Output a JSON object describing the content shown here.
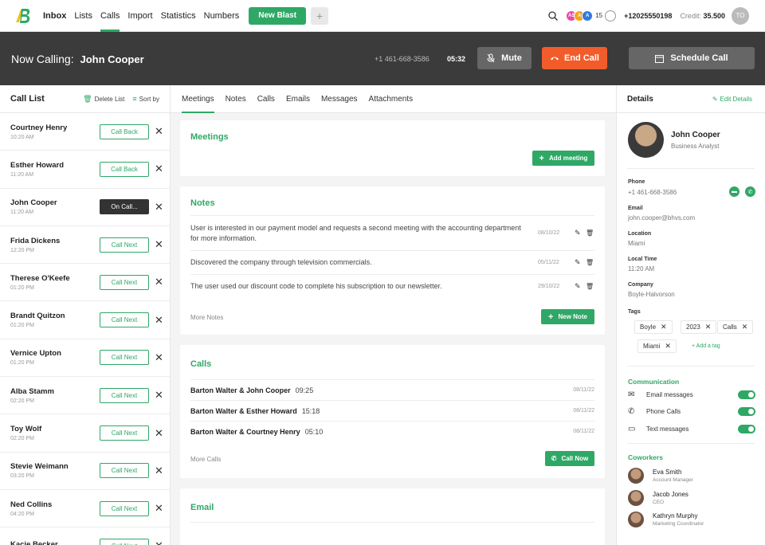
{
  "nav": {
    "items": [
      {
        "label": "Inbox",
        "bold": true,
        "active": false
      },
      {
        "label": "Lists",
        "bold": false,
        "active": false
      },
      {
        "label": "Calls",
        "bold": false,
        "active": true
      },
      {
        "label": "Import",
        "bold": false,
        "active": false
      },
      {
        "label": "Statistics",
        "bold": false,
        "active": false
      },
      {
        "label": "Numbers",
        "bold": false,
        "active": false
      }
    ],
    "new_blast": "New Blast",
    "plus": "+",
    "avatars": [
      {
        "initials": "AS",
        "color": "#e94aa8"
      },
      {
        "initials": "A",
        "color": "#f2a51c"
      },
      {
        "initials": "A",
        "color": "#2f7ae0"
      }
    ],
    "avatar_count": "15",
    "phone": "+12025550198",
    "credit_label": "Credit:",
    "credit_value": "35.500",
    "user_initials": "TO",
    "accent": "#2fa866"
  },
  "banner": {
    "label": "Now Calling:",
    "name": "John Cooper",
    "number": "+1 461-668-3586",
    "timer": "05:32",
    "mute": "Mute",
    "end": "End Call",
    "schedule": "Schedule Call"
  },
  "calllist": {
    "title": "Call List",
    "delete_label": "Delete List",
    "sort_label": "Sort by",
    "rows": [
      {
        "name": "Courtney Henry",
        "time": "10:20 AM",
        "action": "Call Back"
      },
      {
        "name": "Esther Howard",
        "time": "11:20 AM",
        "action": "Call Back"
      },
      {
        "name": "John Cooper",
        "time": "11:20 AM",
        "action": "On Call..."
      },
      {
        "name": "Frida Dickens",
        "time": "12:20 PM",
        "action": "Call Next"
      },
      {
        "name": "Therese O'Keefe",
        "time": "01:20 PM",
        "action": "Call Next"
      },
      {
        "name": "Brandt Quitzon",
        "time": "01:20 PM",
        "action": "Call Next"
      },
      {
        "name": "Vernice Upton",
        "time": "01:20 PM",
        "action": "Call Next"
      },
      {
        "name": "Alba Stamm",
        "time": "02:20 PM",
        "action": "Call Next"
      },
      {
        "name": "Toy Wolf",
        "time": "02:20 PM",
        "action": "Call Next"
      },
      {
        "name": "Stevie Weimann",
        "time": "03:20 PM",
        "action": "Call Next"
      },
      {
        "name": "Ned Collins",
        "time": "04:20 PM",
        "action": "Call Next"
      },
      {
        "name": "Kacie Becker",
        "time": "",
        "action": "Call Next"
      }
    ]
  },
  "tabs": [
    "Meetings",
    "Notes",
    "Calls",
    "Emails",
    "Messages",
    "Attachments"
  ],
  "meetings": {
    "title": "Meetings",
    "add": "Add meeting"
  },
  "notes": {
    "title": "Notes",
    "items": [
      {
        "text": "User is interested in our payment model and requests a second meeting with the accounting department for more information.",
        "date": "08/10/22"
      },
      {
        "text": "Discovered the company through television commercials.",
        "date": "05/11/22"
      },
      {
        "text": "The user used our discount code to complete his subscription to our newsletter.",
        "date": "29/10/22"
      }
    ],
    "more": "More Notes",
    "new": "New Note"
  },
  "calls": {
    "title": "Calls",
    "items": [
      {
        "name": "Barton Walter & John Cooper",
        "duration": "09:25",
        "date": "08/11/22"
      },
      {
        "name": "Barton Walter & Esther Howard",
        "duration": "15:18",
        "date": "08/11/22"
      },
      {
        "name": "Barton Walter & Courtney Henry",
        "duration": "05:10",
        "date": "08/11/22"
      }
    ],
    "more": "More Calls",
    "call_now": "Call Now"
  },
  "email": {
    "title": "Email"
  },
  "details": {
    "title": "Details",
    "edit": "Edit Details",
    "name": "John Cooper",
    "role": "Business Analyst",
    "phone_label": "Phone",
    "phone": "+1 461-668-3586",
    "email_label": "Email",
    "email": "john.cooper@bhvs.com",
    "location_label": "Location",
    "location": "Miami",
    "localtime_label": "Local Time",
    "localtime": "11:20 AM",
    "company_label": "Company",
    "company": "Boyle-Halvorson",
    "tags_label": "Tags",
    "tags": [
      "Boyle",
      "2023",
      "Calls",
      "Miami"
    ],
    "add_tag": "+ Add a tag",
    "communication_label": "Communication",
    "communication": [
      {
        "label": "Email messages",
        "icon": "email-icon",
        "on": true
      },
      {
        "label": "Phone Calls",
        "icon": "phone-icon",
        "on": true
      },
      {
        "label": "Text messages",
        "icon": "message-icon",
        "on": true
      }
    ],
    "coworkers_label": "Coworkers",
    "coworkers": [
      {
        "name": "Eva Smith",
        "role": "Account Manager"
      },
      {
        "name": "Jacob Jones",
        "role": "CEO"
      },
      {
        "name": "Kathryn Murphy",
        "role": "Marketing Coordinator"
      }
    ]
  }
}
